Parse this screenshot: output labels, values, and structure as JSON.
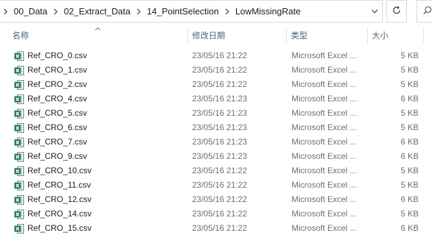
{
  "breadcrumb": [
    "00_Data",
    "02_Extract_Data",
    "14_PointSelection",
    "LowMissingRate"
  ],
  "columns": {
    "name": "名称",
    "date": "修改日期",
    "type": "类型",
    "size": "大小"
  },
  "files": [
    {
      "name": "Ref_CRO_0.csv",
      "date": "23/05/16 21:22",
      "type": "Microsoft Excel ...",
      "size": "5 KB"
    },
    {
      "name": "Ref_CRO_1.csv",
      "date": "23/05/16 21:22",
      "type": "Microsoft Excel ...",
      "size": "5 KB"
    },
    {
      "name": "Ref_CRO_2.csv",
      "date": "23/05/16 21:22",
      "type": "Microsoft Excel ...",
      "size": "5 KB"
    },
    {
      "name": "Ref_CRO_4.csv",
      "date": "23/05/16 21:23",
      "type": "Microsoft Excel ...",
      "size": "6 KB"
    },
    {
      "name": "Ref_CRO_5.csv",
      "date": "23/05/16 21:23",
      "type": "Microsoft Excel ...",
      "size": "5 KB"
    },
    {
      "name": "Ref_CRO_6.csv",
      "date": "23/05/16 21:23",
      "type": "Microsoft Excel ...",
      "size": "5 KB"
    },
    {
      "name": "Ref_CRO_7.csv",
      "date": "23/05/16 21:23",
      "type": "Microsoft Excel ...",
      "size": "6 KB"
    },
    {
      "name": "Ref_CRO_9.csv",
      "date": "23/05/16 21:23",
      "type": "Microsoft Excel ...",
      "size": "6 KB"
    },
    {
      "name": "Ref_CRO_10.csv",
      "date": "23/05/16 21:22",
      "type": "Microsoft Excel ...",
      "size": "5 KB"
    },
    {
      "name": "Ref_CRO_11.csv",
      "date": "23/05/16 21:22",
      "type": "Microsoft Excel ...",
      "size": "5 KB"
    },
    {
      "name": "Ref_CRO_12.csv",
      "date": "23/05/16 21:22",
      "type": "Microsoft Excel ...",
      "size": "6 KB"
    },
    {
      "name": "Ref_CRO_14.csv",
      "date": "23/05/16 21:22",
      "type": "Microsoft Excel ...",
      "size": "5 KB"
    },
    {
      "name": "Ref_CRO_15.csv",
      "date": "23/05/16 21:22",
      "type": "Microsoft Excel ...",
      "size": "6 KB"
    }
  ],
  "icons": {
    "file": "excel-csv-icon",
    "refresh": "refresh-icon",
    "search": "search-icon",
    "dropdown": "chevron-down-icon",
    "separator": "chevron-right-icon",
    "sort": "sort-ascending-icon"
  },
  "colors": {
    "excel_green": "#1e7145",
    "header_text": "#4c607a",
    "secondary_text": "#6d6d6d"
  }
}
